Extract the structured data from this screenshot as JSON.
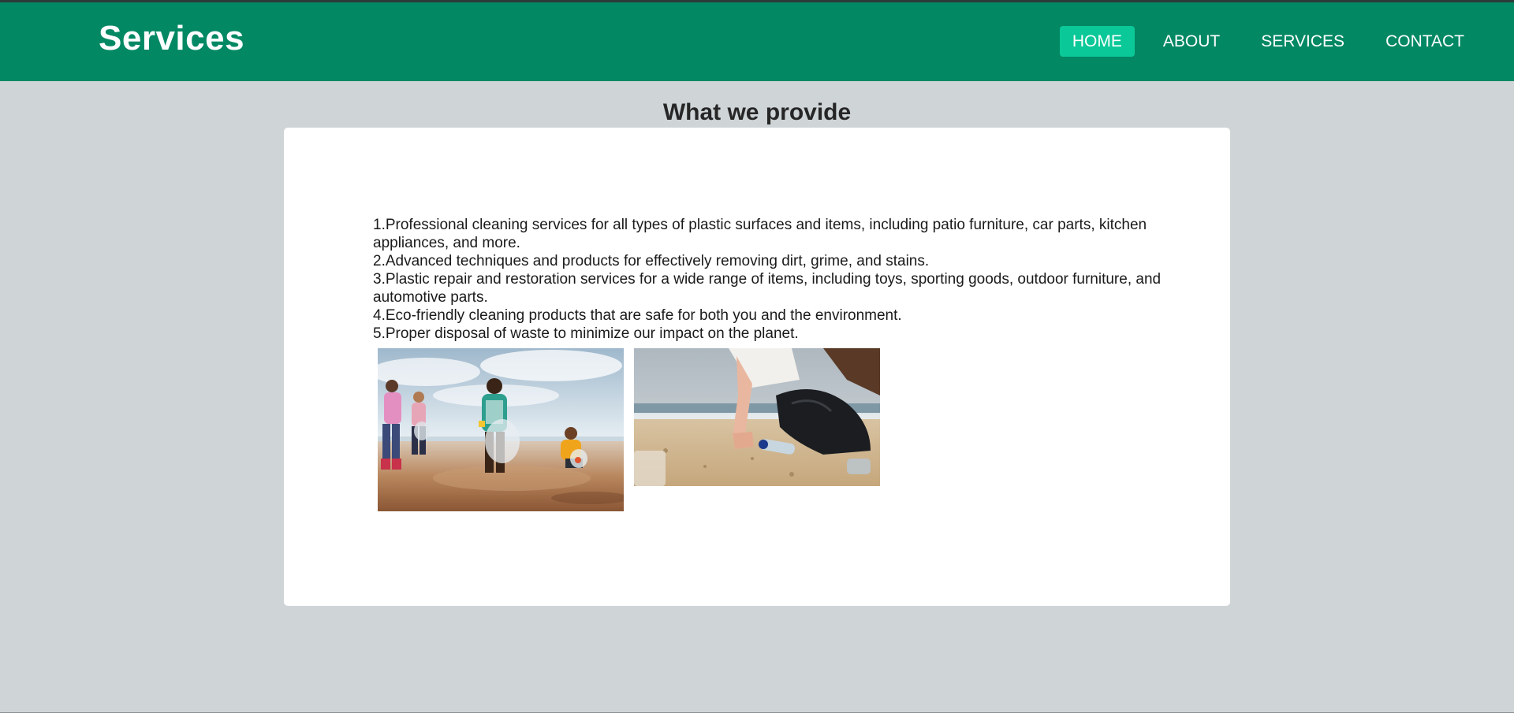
{
  "header": {
    "brand": "Services",
    "nav": [
      {
        "label": "HOME",
        "active": true
      },
      {
        "label": "ABOUT",
        "active": false
      },
      {
        "label": "SERVICES",
        "active": false
      },
      {
        "label": "CONTACT",
        "active": false
      }
    ]
  },
  "main": {
    "title": "What we provide",
    "services": [
      "1.Professional cleaning services for all types of plastic surfaces and items, including patio furniture, car parts, kitchen appliances, and more.",
      "2.Advanced techniques and products for effectively removing dirt, grime, and stains.",
      "3.Plastic repair and restoration services for a wide range of items, including toys, sporting goods, outdoor furniture, and automotive parts.",
      "4.Eco-friendly cleaning products that are safe for both you and the environment.",
      "5.Proper disposal of waste to minimize our impact on the planet."
    ]
  },
  "colors": {
    "header_bg": "#038864",
    "active_nav_bg": "#0bc898",
    "page_bg": "#cfd4d7",
    "card_bg": "#ffffff"
  }
}
